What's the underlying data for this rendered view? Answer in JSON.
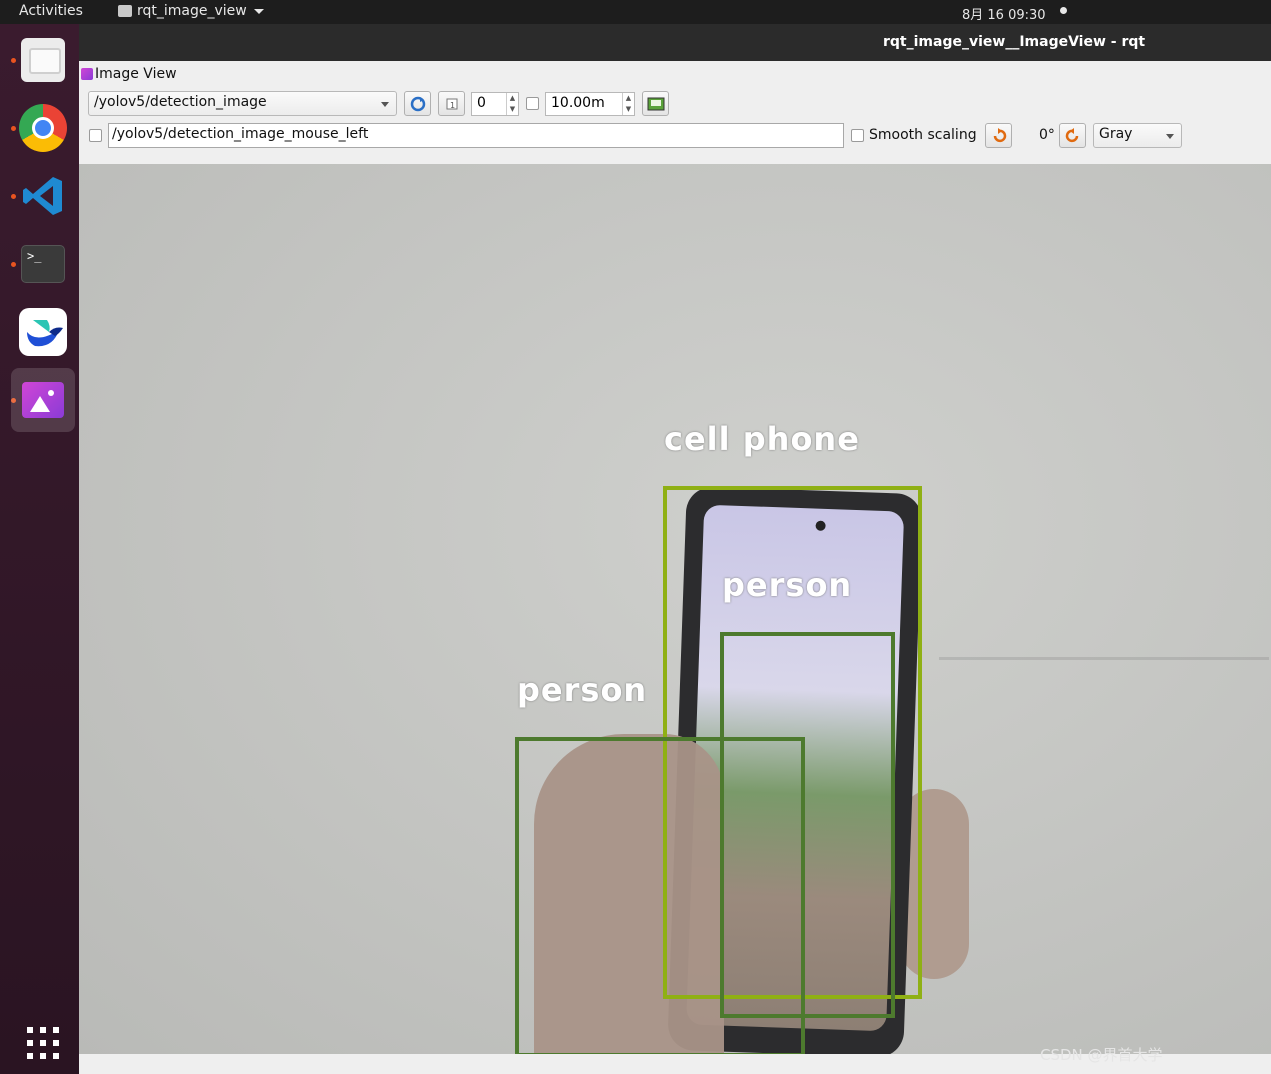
{
  "topbar": {
    "activities": "Activities",
    "app_name": "rqt_image_view",
    "clock": "8月 16  09:30"
  },
  "dock": {
    "items": [
      "files-icon",
      "chrome-icon",
      "vscode-icon",
      "terminal-icon",
      "feishu-icon",
      "image-viewer-icon",
      "show-apps-icon"
    ],
    "terminal_glyph": ">_"
  },
  "window": {
    "title": "rqt_image_view__ImageView - rqt",
    "plugin_title": "Image View"
  },
  "toolbar": {
    "topic": "/yolov5/detection_image",
    "spin_value": "0",
    "rate_value": "10.00m",
    "mouse_topic": "/yolov5/detection_image_mouse_left",
    "smooth_scaling_label": "Smooth scaling",
    "rotation": "0°",
    "color_mode": "Gray"
  },
  "detections": [
    {
      "label": "cell phone",
      "color": "#8fb014"
    },
    {
      "label": "person",
      "color": "#4d7a2e"
    },
    {
      "label": "person",
      "color": "#4d7a2e"
    }
  ],
  "watermark": "CSDN @界首大学"
}
